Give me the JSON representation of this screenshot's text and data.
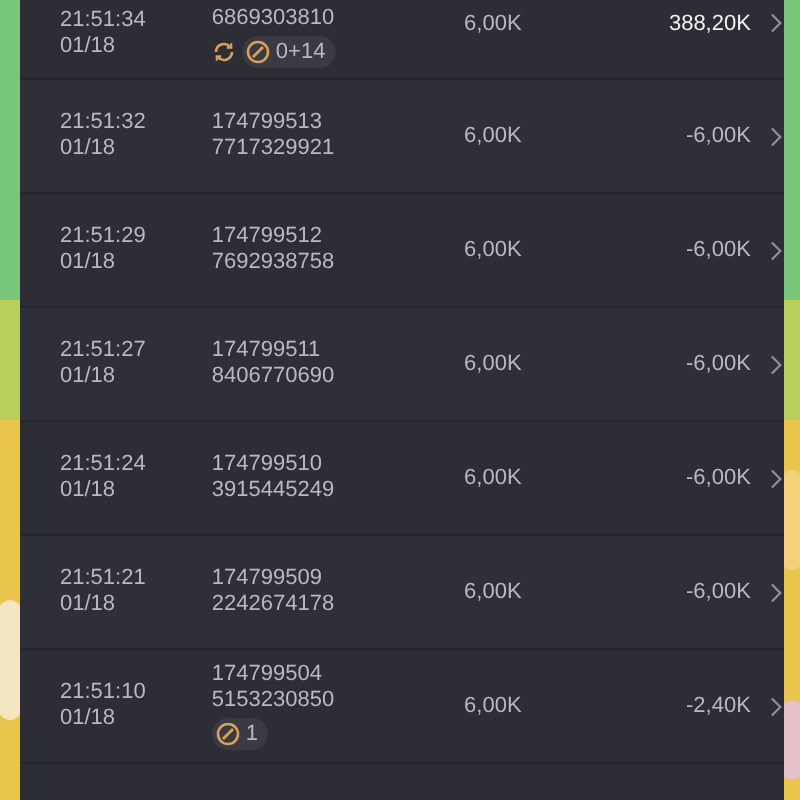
{
  "rows": [
    {
      "time": "21:51:34",
      "date": "01/18",
      "ids": [
        "6869303810"
      ],
      "stake": "6,00K",
      "result": "388,20K",
      "positive": true,
      "badges": [
        {
          "kind": "refresh"
        },
        {
          "kind": "pill",
          "text": "0+14"
        }
      ]
    },
    {
      "time": "21:51:32",
      "date": "01/18",
      "ids": [
        "174799513",
        "7717329921"
      ],
      "stake": "6,00K",
      "result": "-6,00K",
      "positive": false,
      "badges": []
    },
    {
      "time": "21:51:29",
      "date": "01/18",
      "ids": [
        "174799512",
        "7692938758"
      ],
      "stake": "6,00K",
      "result": "-6,00K",
      "positive": false,
      "badges": []
    },
    {
      "time": "21:51:27",
      "date": "01/18",
      "ids": [
        "174799511",
        "8406770690"
      ],
      "stake": "6,00K",
      "result": "-6,00K",
      "positive": false,
      "badges": []
    },
    {
      "time": "21:51:24",
      "date": "01/18",
      "ids": [
        "174799510",
        "3915445249"
      ],
      "stake": "6,00K",
      "result": "-6,00K",
      "positive": false,
      "badges": []
    },
    {
      "time": "21:51:21",
      "date": "01/18",
      "ids": [
        "174799509",
        "2242674178"
      ],
      "stake": "6,00K",
      "result": "-6,00K",
      "positive": false,
      "badges": []
    },
    {
      "time": "21:51:10",
      "date": "01/18",
      "ids": [
        "174799504",
        "5153230850"
      ],
      "stake": "6,00K",
      "result": "-2,40K",
      "positive": false,
      "badges": [
        {
          "kind": "pill",
          "text": "1"
        }
      ]
    }
  ]
}
